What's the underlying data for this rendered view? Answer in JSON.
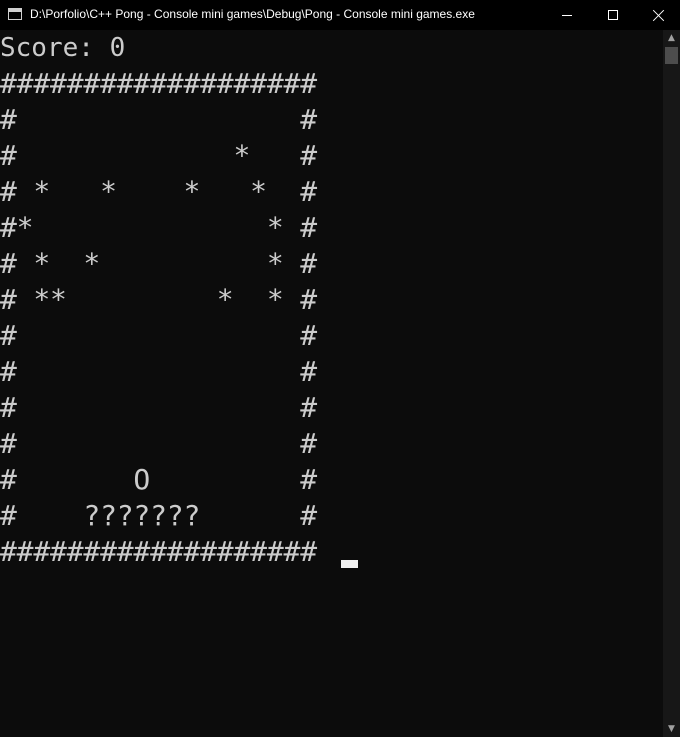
{
  "window": {
    "title": "D:\\Porfolio\\C++ Pong - Console mini games\\Debug\\Pong - Console mini games.exe",
    "minimize_glyph": "",
    "close_glyph": ""
  },
  "console": {
    "score_text": "Score: 0",
    "rows": [
      "###################",
      "#                 #",
      "#             *   #",
      "# *   *    *   *  #",
      "#*              * #",
      "# *  *          * #",
      "# **         *  * #",
      "#                 #",
      "#                 #",
      "#                 #",
      "#                 #",
      "#       O         #",
      "#    ???????      #",
      "###################"
    ]
  },
  "scrollbar": {
    "up_arrow": "▲",
    "down_arrow": "▼"
  }
}
